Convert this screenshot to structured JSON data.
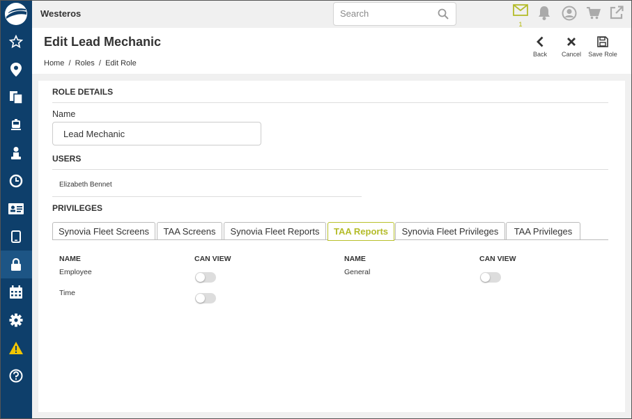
{
  "app": {
    "name": "Westeros"
  },
  "search": {
    "placeholder": "Search"
  },
  "topbar": {
    "mail_count": "1"
  },
  "colors": {
    "sidebar": "#0e3f6b",
    "sidebar_active": "#1d5585",
    "accent": "#b4bc2a",
    "warning": "#f2c500"
  },
  "sidebar": {
    "items": [
      "favorites-icon",
      "location-icon",
      "documents-icon",
      "vehicles-icon",
      "driver-icon",
      "clock-icon",
      "id-card-icon",
      "tablet-icon",
      "lock-icon",
      "calendar-icon",
      "gear-icon",
      "warning-icon",
      "help-icon"
    ],
    "active": "lock-icon"
  },
  "page": {
    "title": "Edit Lead Mechanic",
    "breadcrumb": [
      "Home",
      "Roles",
      "Edit Role"
    ],
    "actions": {
      "back": "Back",
      "cancel": "Cancel",
      "save": "Save Role"
    }
  },
  "role": {
    "section_title": "ROLE DETAILS",
    "name_label": "Name",
    "name_value": "Lead Mechanic"
  },
  "users": {
    "section_title": "USERS",
    "list": [
      "Elizabeth Bennet"
    ]
  },
  "privileges": {
    "section_title": "PRIVILEGES",
    "tabs": [
      "Synovia Fleet Screens",
      "TAA Screens",
      "Synovia Fleet Reports",
      "TAA Reports",
      "Synovia Fleet Privileges",
      "TAA Privileges"
    ],
    "active_tab": "TAA Reports",
    "columns": {
      "name": "NAME",
      "can_view": "CAN VIEW"
    },
    "left_rows": [
      {
        "name": "Employee",
        "can_view": false
      },
      {
        "name": "Time",
        "can_view": false
      }
    ],
    "right_rows": [
      {
        "name": "General",
        "can_view": false
      }
    ]
  }
}
